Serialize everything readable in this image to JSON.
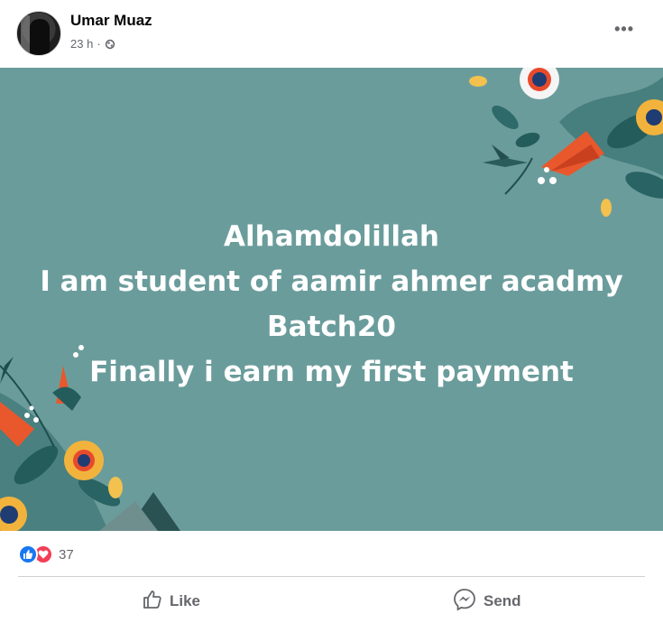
{
  "post": {
    "author": "Umar Muaz",
    "time": "23 h",
    "separator": "·",
    "audience_icon": "globe-icon",
    "more_label": "•••"
  },
  "image": {
    "background_color": "#6b9c9c",
    "lines": [
      "Alhamdolillah",
      "I am student of aamir ahmer acadmy",
      "Batch20",
      "Finally i earn my first payment"
    ]
  },
  "reactions": {
    "icons": [
      "like-reaction-icon",
      "love-reaction-icon"
    ],
    "count": "37"
  },
  "actions": {
    "like_label": "Like",
    "send_label": "Send"
  },
  "colors": {
    "brand_blue": "#1877f2",
    "love_red": "#f33e58",
    "secondary_text": "#65676b"
  }
}
